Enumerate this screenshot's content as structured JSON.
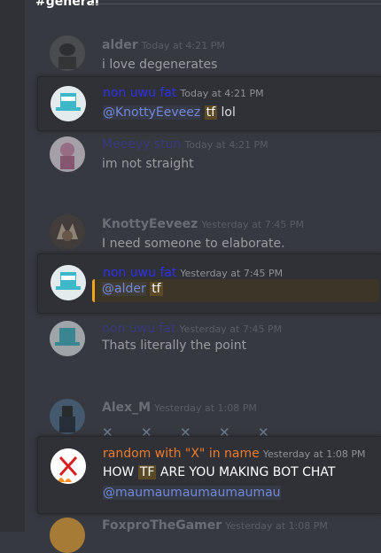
{
  "channel": {
    "name": "#general"
  },
  "messages": [
    {
      "author": "alder",
      "color": "#8e9297",
      "time": "Today at 4:21 PM",
      "text": "i love degenerates"
    },
    {
      "author": "non uwu fat",
      "color": "#2f2ff0",
      "time": "Today at 4:21 PM",
      "mention": "@KnottyEeveez",
      "highlight": "tf",
      "text": "lol"
    },
    {
      "author": "Meeeyy stun",
      "color": "#3a3aa8",
      "time": "Today at 4:21 PM",
      "text": "im not straight"
    },
    {
      "author": "KnottyEeveez",
      "color": "#8e9297",
      "time": "Yesterday at 7:45 PM",
      "text": "I need someone to elaborate."
    },
    {
      "author": "non uwu fat",
      "color": "#2f2ff0",
      "time": "Yesterday at 7:45 PM",
      "mention": "@alder",
      "highlight": "tf"
    },
    {
      "author": "non uwu fat",
      "color": "#3a3aa8",
      "time": "Yesterday at 7:45 PM",
      "text": "Thats literally the point"
    },
    {
      "author": "Alex_M",
      "color": "#8e9297",
      "time": "Yesterday at 1:08 PM",
      "emoji": [
        "✕",
        "✕",
        "✕",
        "✕",
        "✕"
      ]
    },
    {
      "author": "random with \"X\" in name",
      "color": "#f47b2a",
      "time": "Yesterday at 1:08 PM",
      "text_before": "HOW",
      "highlight": "TF",
      "text_after": "ARE YOU MAKING BOT CHAT",
      "mention": "@maumaumaumaumaumau"
    },
    {
      "author": "FoxproTheGamer",
      "color": "#8e9297",
      "time": "Yesterday at 1:08 PM"
    }
  ]
}
